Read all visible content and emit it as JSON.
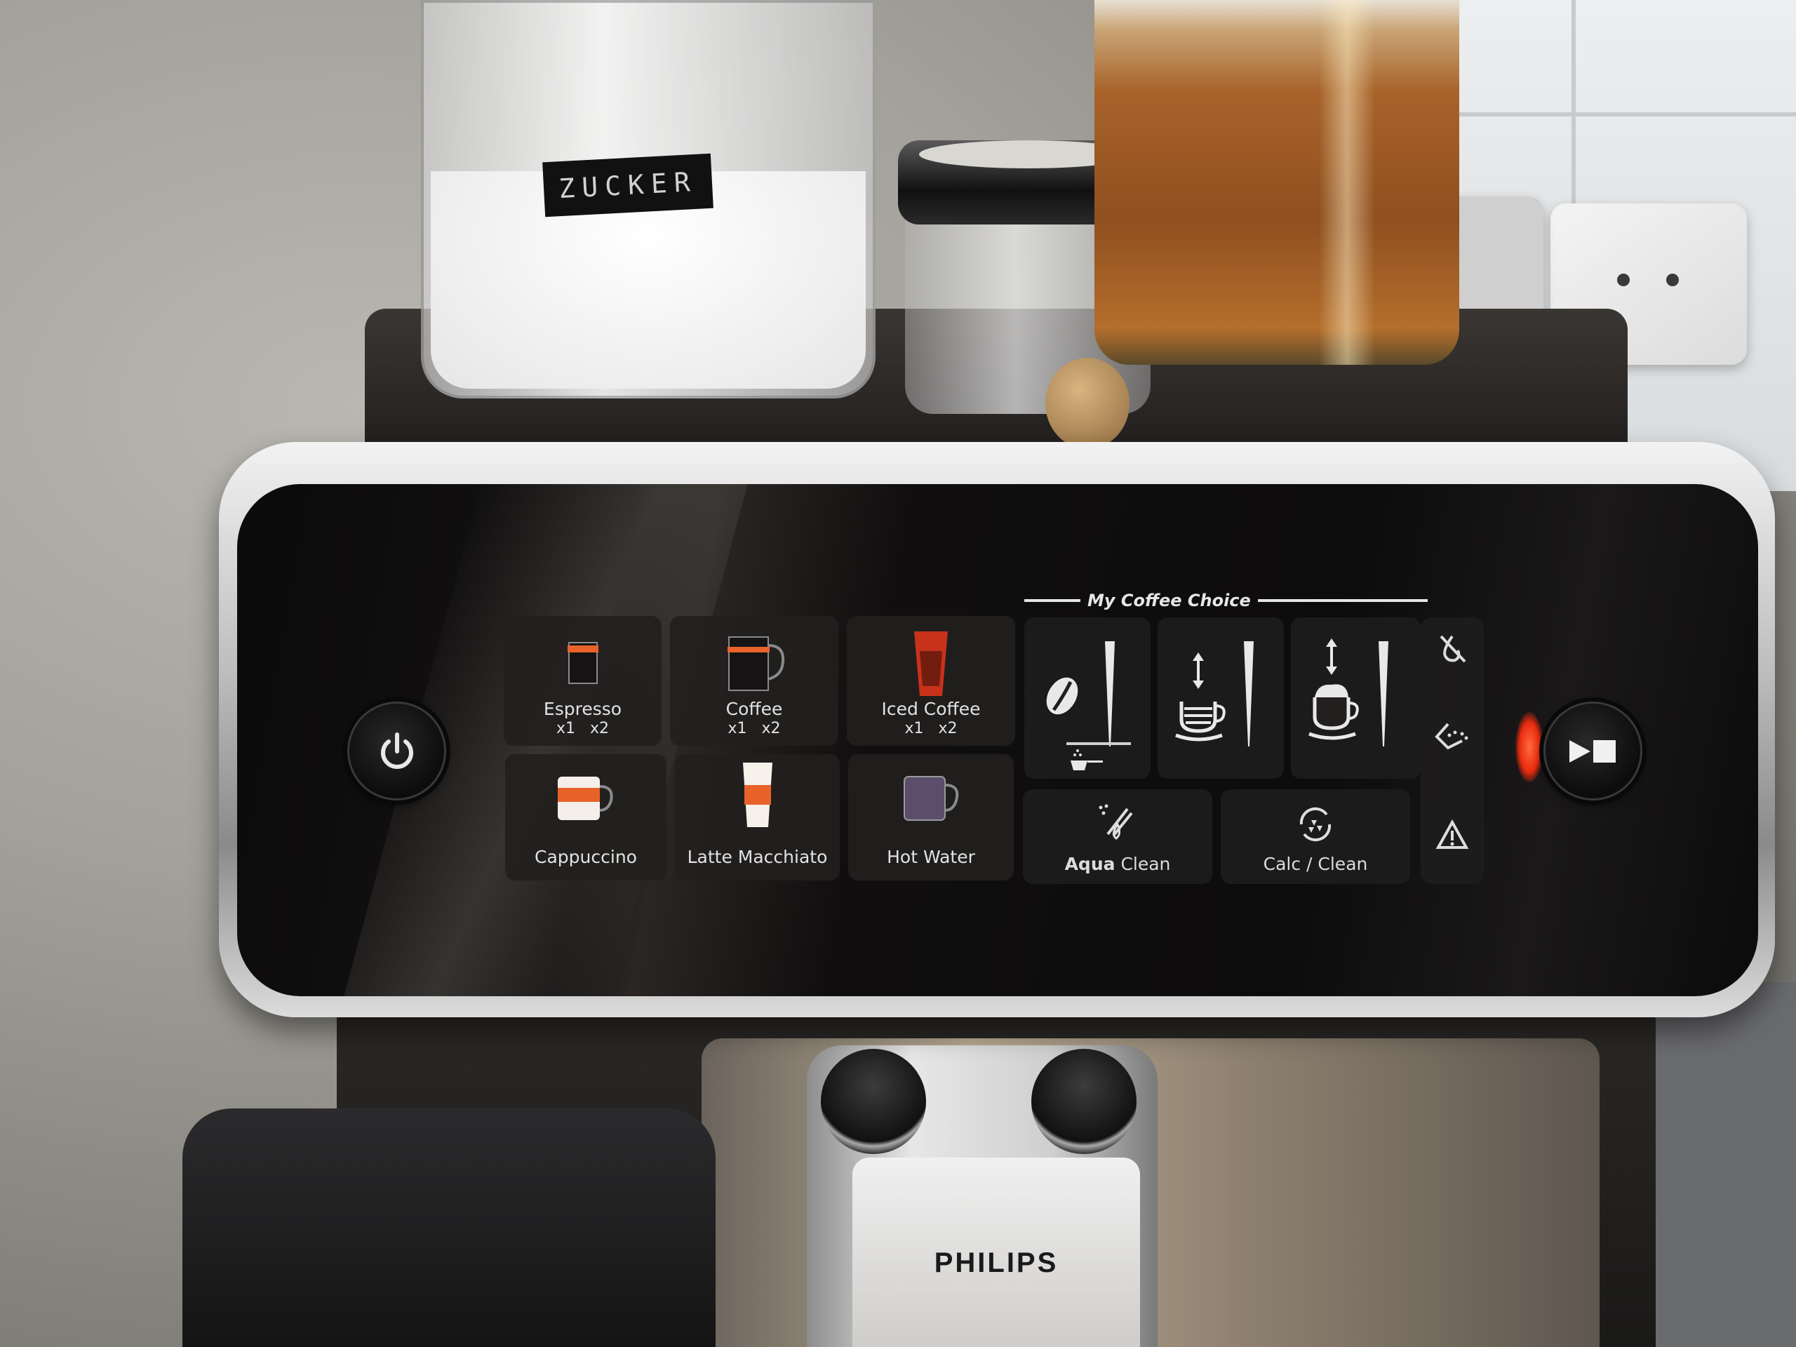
{
  "scene": {
    "jar_label": "ZUCKER",
    "brand_logo": "PHILIPS"
  },
  "panel": {
    "power_button": {
      "icon": "power-icon",
      "label": "Power"
    },
    "start_stop_button": {
      "icon": "play-stop-icon",
      "label": "Start / Stop"
    },
    "drinks": [
      {
        "name": "Espresso",
        "dose": "x1 x2",
        "icon": "espresso-cup-icon"
      },
      {
        "name": "Coffee",
        "dose": "x1 x2",
        "icon": "coffee-mug-icon"
      },
      {
        "name": "Iced Coffee",
        "dose": "x1 x2",
        "icon": "iced-coffee-glass-icon"
      },
      {
        "name": "Cappuccino",
        "dose": "",
        "icon": "cappuccino-cup-icon"
      },
      {
        "name": "Latte Macchiato",
        "dose": "",
        "icon": "latte-macchiato-glass-icon"
      },
      {
        "name": "Hot Water",
        "dose": "",
        "icon": "hot-water-cup-icon"
      }
    ],
    "my_coffee_choice": {
      "title": "My Coffee Choice",
      "options": [
        {
          "name": "Aroma strength / ground coffee",
          "icon": "coffee-bean-icon"
        },
        {
          "name": "Coffee quantity",
          "icon": "coffee-quantity-icon"
        },
        {
          "name": "Milk quantity",
          "icon": "milk-quantity-icon"
        }
      ]
    },
    "maintenance": [
      {
        "name_bold": "Aqua",
        "name_rest": " Clean",
        "icon": "aqua-clean-filter-icon"
      },
      {
        "name_bold": "",
        "name_rest": "Calc / Clean",
        "icon": "calc-clean-icon"
      }
    ],
    "status_indicators": [
      {
        "name": "Water tank empty",
        "icon": "water-drop-crossed-icon"
      },
      {
        "name": "Grounds container",
        "icon": "grounds-container-icon"
      },
      {
        "name": "General warning",
        "icon": "warning-triangle-icon"
      }
    ],
    "colors": {
      "panel_bg": "#0f0e0e",
      "tile_bg": "#221f1e",
      "text": "#e2e2e2",
      "led_red": "#e92b0f",
      "coffee_orange": "#e8632a"
    }
  }
}
